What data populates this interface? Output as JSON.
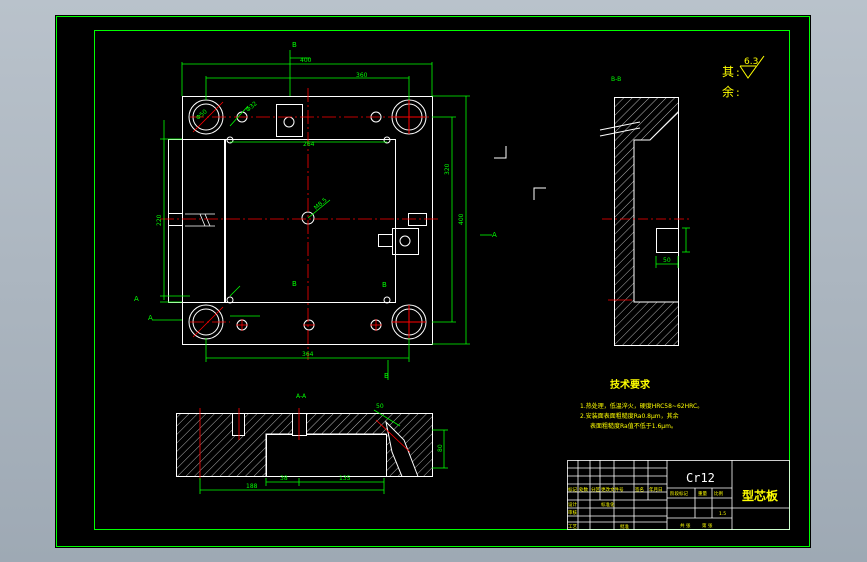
{
  "colors": {
    "viewport_bg": "#9ea9b4",
    "sheet_bg": "#000000",
    "frame": "#00ff00",
    "part_outline": "#ffffff",
    "dimension": "#00ff00",
    "centerline": "#ff0000",
    "hatch": "#ffffff",
    "text_yellow": "#ffff00",
    "text_white": "#ffffff"
  },
  "drawing": {
    "material": "Cr12",
    "part_name": "型芯板",
    "roughness_label_top": "其",
    "roughness_label_mid": "余",
    "roughness_value": "6.3",
    "tech_title": "技术要求",
    "tech_note_1": "1.热处理，低温淬火，硬度HRC58~62HRC。",
    "tech_note_2": "2.安装面表面粗糙度Ra0.8μm，其余",
    "tech_note_3": "表面粗糙度Ra值不低于1.6μm。",
    "section_label_top": "B-B",
    "section_label_bottom": "A-A",
    "marker_a": "A",
    "marker_b": "B",
    "scale": "1:1",
    "sheet_count": "1.5"
  },
  "dimensions": {
    "overall_width": "400",
    "inner_width": "360",
    "pocket_width": "264",
    "bottom_width": "364",
    "right_height": "400",
    "right_inner": "320",
    "left_height": "220",
    "pocket_depth": "50",
    "hole_dia_1": "Φ50",
    "hole_dia_2": "Φ32",
    "hole_dia_3": "M8.5",
    "bottom_len_1": "188",
    "bottom_len_2": "38",
    "bottom_len_3": "135",
    "right_side_dim": "80",
    "side_dim_2": "50"
  },
  "title_block": {
    "r1c1": "标记",
    "r1c2": "处数",
    "r1c3": "分区",
    "r1c4": "更改文件号",
    "r1c5": "签名",
    "r1c6": "年月日",
    "r2c1": "设计",
    "r2c2": "标准化",
    "r3c1": "审核",
    "r4c1": "工艺",
    "r4c2": "批准",
    "stage": "阶段标记",
    "weight": "重量",
    "ratio": "比例",
    "sheet_total": "共 张",
    "sheet_no": "第 张"
  }
}
